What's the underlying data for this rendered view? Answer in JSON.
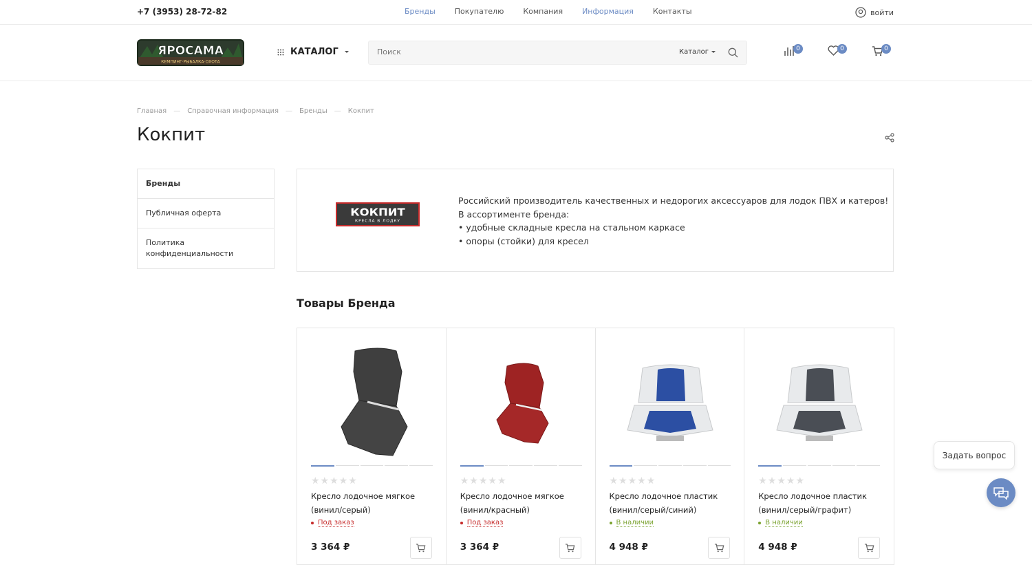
{
  "topbar": {
    "phone": "+7 (3953) 28-72-82",
    "nav": [
      {
        "label": "Бренды",
        "active": true
      },
      {
        "label": "Покупателю",
        "active": false
      },
      {
        "label": "Компания",
        "active": false
      },
      {
        "label": "Информация",
        "active": true
      },
      {
        "label": "Контакты",
        "active": false
      }
    ],
    "login_label": "войти"
  },
  "header": {
    "logo_text": "ЯРОСАМА",
    "logo_subtext": "КЕМПИНГ·РЫБАЛКА·ОХОТА",
    "catalog_label": "КАТАЛОГ",
    "search": {
      "placeholder": "Поиск",
      "scope": "Каталог"
    },
    "compare_count": "0",
    "favorites_count": "0",
    "cart_count": "0"
  },
  "breadcrumb": [
    "Главная",
    "Справочная информация",
    "Бренды",
    "Кокпит"
  ],
  "page_title": "Кокпит",
  "side_menu": [
    {
      "label": "Бренды",
      "active": true
    },
    {
      "label": "Публичная оферта",
      "active": false
    },
    {
      "label": "Политика конфиденциальности",
      "active": false
    }
  ],
  "brand": {
    "logo_text": "КОКПИТ",
    "logo_subtext": "КРЕСЛА В ЛОДКУ",
    "description": [
      "Российский производитель качественных и недорогих аксессуаров для лодок ПВХ и катеров!",
      "В ассортименте бренда:",
      "• удобные складные кресла на стальном каркасе",
      "• опоры (стойки) для кресел"
    ]
  },
  "products_title": "Товары Бренда",
  "products": [
    {
      "name": "Кресло лодочное мягкое (винил/серый)",
      "stock": "Под заказ",
      "stock_color": "#c62b2b",
      "price": "3 364 ₽",
      "seat_color": "#3f3f3f"
    },
    {
      "name": "Кресло лодочное мягкое (винил/красный)",
      "stock": "Под заказ",
      "stock_color": "#c62b2b",
      "price": "3 364 ₽",
      "seat_color": "#9e2323"
    },
    {
      "name": "Кресло лодочное пластик (винил/серый/синий)",
      "stock": "В наличии",
      "stock_color": "#7aa22f",
      "price": "4 948 ₽",
      "seat_color": "#2c4fa3"
    },
    {
      "name": "Кресло лодочное пластик (винил/серый/графит)",
      "stock": "В наличии",
      "stock_color": "#7aa22f",
      "price": "4 948 ₽",
      "seat_color": "#4a4e55"
    }
  ],
  "ask_label": "Задать вопрос",
  "colors": {
    "accent": "#6b8bc4",
    "brand_red": "#c62b2b",
    "in_stock": "#7aa22f"
  }
}
